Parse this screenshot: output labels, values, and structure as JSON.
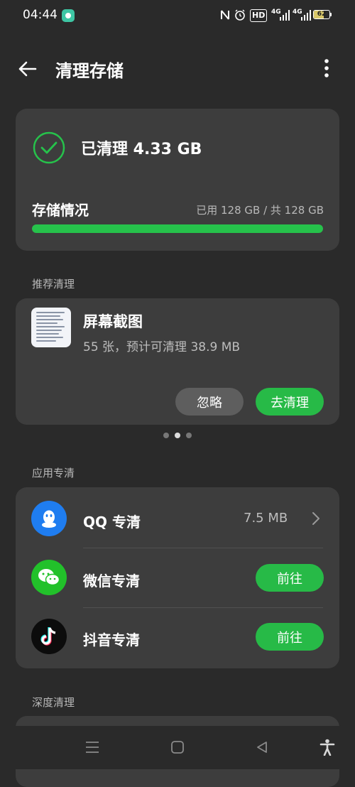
{
  "status_bar": {
    "time": "04:44",
    "hd_label": "HD",
    "signal1": "4G",
    "signal2": "4G",
    "battery": "62"
  },
  "header": {
    "title": "清理存储"
  },
  "summary": {
    "cleaned_text": "已清理 4.33 GB",
    "storage_label": "存储情况",
    "storage_usage": "已用 128 GB / 共 128 GB",
    "usage_fraction": 1.0,
    "accent_color": "#26c24b"
  },
  "recommended": {
    "section_title": "推荐清理",
    "item_title": "屏幕截图",
    "item_subtitle": "55 张，预计可清理 38.9 MB",
    "ignore_label": "忽略",
    "clean_label": "去清理",
    "page_count": 3,
    "active_page": 1
  },
  "apps": {
    "section_title": "应用专清",
    "items": [
      {
        "label": "QQ 专清",
        "size": "7.5 MB",
        "icon": "qq-icon"
      },
      {
        "label": "微信专清",
        "action": "前往",
        "icon": "wechat-icon"
      },
      {
        "label": "抖音专清",
        "action": "前往",
        "icon": "douyin-icon"
      }
    ]
  },
  "deep": {
    "section_title": "深度清理"
  },
  "nav": {
    "icons": [
      "menu-icon",
      "home-icon",
      "back-icon",
      "accessibility-icon"
    ]
  }
}
